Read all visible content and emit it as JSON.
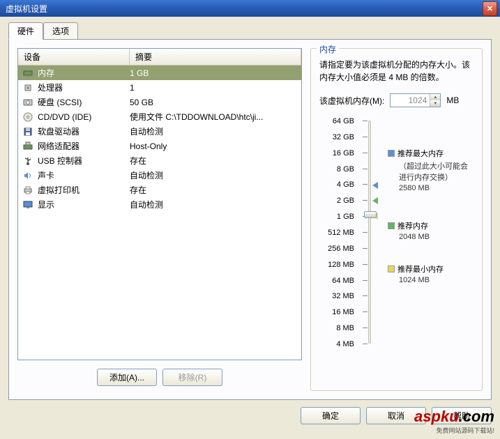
{
  "window": {
    "title": "虚拟机设置"
  },
  "tabs": [
    {
      "label": "硬件",
      "active": true
    },
    {
      "label": "选项",
      "active": false
    }
  ],
  "list": {
    "col_device": "设备",
    "col_summary": "摘要",
    "rows": [
      {
        "icon": "memory",
        "name": "内存",
        "summary": "1 GB",
        "selected": true
      },
      {
        "icon": "cpu",
        "name": "处理器",
        "summary": "1"
      },
      {
        "icon": "hdd",
        "name": "硬盘 (SCSI)",
        "summary": "50 GB"
      },
      {
        "icon": "cd",
        "name": "CD/DVD (IDE)",
        "summary": "使用文件 C:\\TDDOWNLOAD\\htc\\ji..."
      },
      {
        "icon": "floppy",
        "name": "软盘驱动器",
        "summary": "自动检测"
      },
      {
        "icon": "nic",
        "name": "网络适配器",
        "summary": "Host-Only"
      },
      {
        "icon": "usb",
        "name": "USB 控制器",
        "summary": "存在"
      },
      {
        "icon": "sound",
        "name": "声卡",
        "summary": "自动检测"
      },
      {
        "icon": "printer",
        "name": "虚拟打印机",
        "summary": "存在"
      },
      {
        "icon": "display",
        "name": "显示",
        "summary": "自动检测"
      }
    ]
  },
  "buttons": {
    "add": "添加(A)...",
    "remove": "移除(R)",
    "ok": "确定",
    "cancel": "取消",
    "help": "帮助"
  },
  "memory": {
    "group_title": "内存",
    "description": "请指定要为该虚拟机分配的内存大小。该内存大小值必须是 4 MB 的倍数。",
    "input_label": "该虚拟机内存(M):",
    "value": "1024",
    "unit": "MB",
    "ticks": [
      "64 GB",
      "32 GB",
      "16 GB",
      "8 GB",
      "4 GB",
      "2 GB",
      "1 GB",
      "512 MB",
      "256 MB",
      "128 MB",
      "64 MB",
      "32 MB",
      "16 MB",
      "8 MB",
      "4 MB"
    ],
    "legend": {
      "max": {
        "label": "推荐最大内存",
        "note": "（超过此大小可能会进行内存交换）",
        "value": "2580 MB",
        "color": "#5a8fd6"
      },
      "rec": {
        "label": "推荐内存",
        "value": "2048 MB",
        "color": "#5fb85f"
      },
      "min": {
        "label": "推荐最小内存",
        "value": "1024 MB",
        "color": "#e8d84f"
      }
    }
  },
  "watermark": {
    "brand": "aspku",
    "suffix": ".com",
    "sub": "免费网站源码下载站!"
  }
}
